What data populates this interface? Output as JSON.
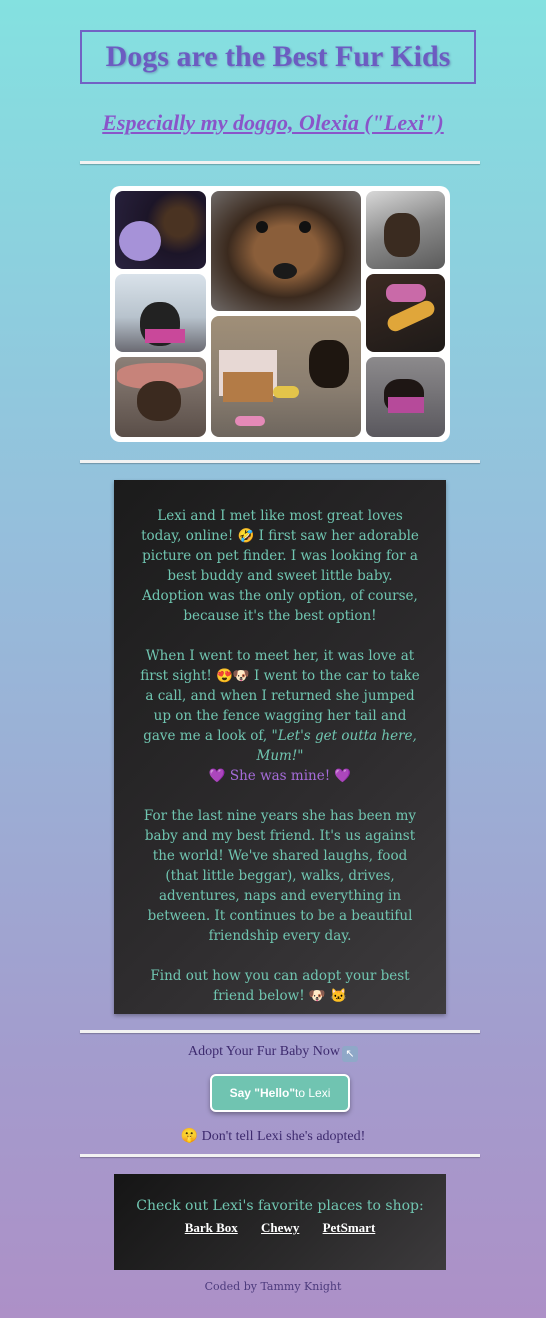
{
  "header": {
    "title": "Dogs are the Best Fur Kids",
    "subtitle": "Especially my doggo, Olexia (\"Lexi\")"
  },
  "story": {
    "p1": "Lexi and I met like most great loves today, online! 🤣 I first saw her adorable picture on pet finder. I was looking for a best buddy and sweet little baby. Adoption was the only option, of course, because it's the best option!",
    "p2_a": "When I went to meet her, it was love at first sight! 😍🐶 I went to the car to take a call, and when I returned she jumped up on the fence wagging her tail and gave me a look of, ",
    "p2_quote": "\"Let's get outta here, Mum!\"",
    "p2_mine": "💜 She was mine! 💜",
    "p3": "For the last nine years she has been my baby and my best friend. It's us against the world! We've shared laughs, food (that little beggar), walks, drives, adventures, naps and everything in between. It continues to be a beautiful friendship every day.",
    "p4": "Find out how you can adopt your best friend below! 🐶 🐱"
  },
  "adopt": {
    "text": "Adopt Your Fur Baby Now",
    "arrow_icon": "↖",
    "button_bold": "Say \"Hello\"",
    "button_rest": " to Lexi",
    "secret": "🤫 Don't tell Lexi she's adopted!"
  },
  "shop": {
    "title": "Check out Lexi's favorite places to shop:",
    "links": [
      "Bark Box",
      "Chewy",
      "PetSmart"
    ]
  },
  "footer": {
    "credit": "Coded by Tammy Knight"
  },
  "colors": {
    "accent": "#6c5cc1",
    "teal": "#70c4b1",
    "purple": "#a56cd9"
  }
}
